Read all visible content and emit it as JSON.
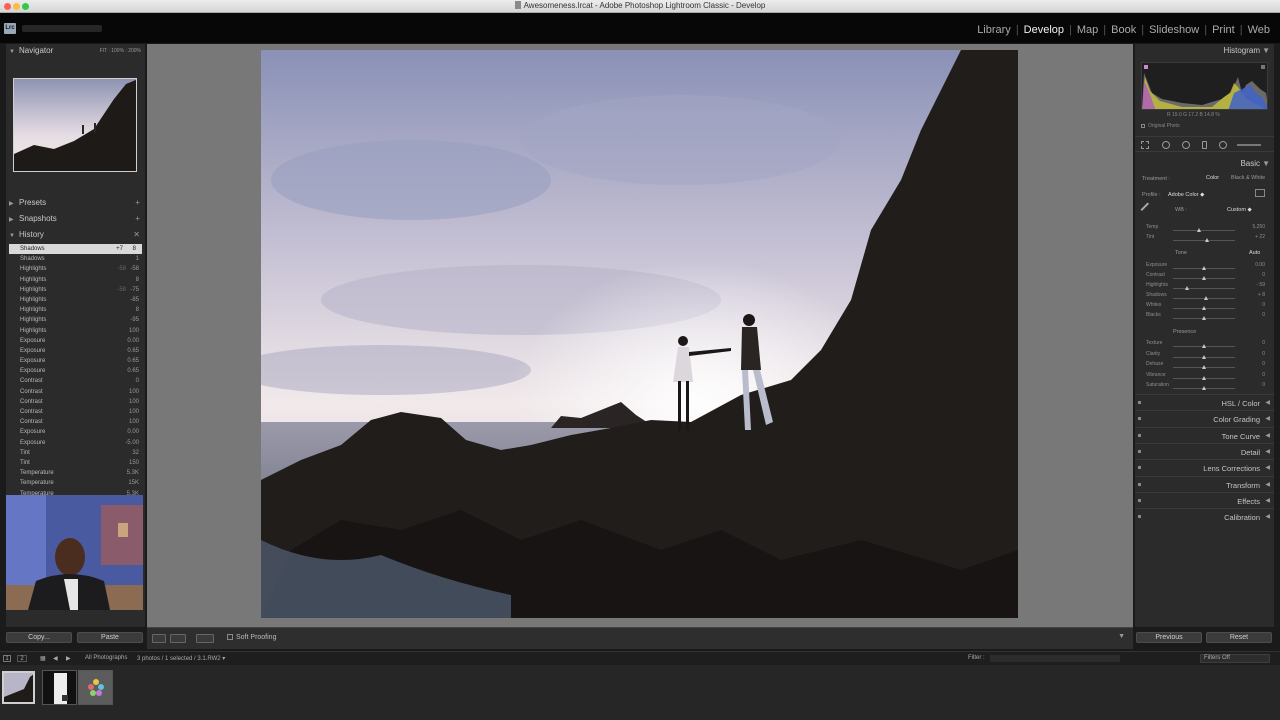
{
  "window": {
    "title": "Awesomeness.lrcat - Adobe Photoshop Lightroom Classic - Develop",
    "app_badge": "Lrc"
  },
  "modules": [
    {
      "label": "Library"
    },
    {
      "label": "Develop",
      "active": true
    },
    {
      "label": "Map"
    },
    {
      "label": "Book"
    },
    {
      "label": "Slideshow"
    },
    {
      "label": "Print"
    },
    {
      "label": "Web"
    }
  ],
  "left_panel": {
    "navigator": {
      "title": "Navigator",
      "zoom_options": [
        "FIT",
        "100%",
        "200%"
      ]
    },
    "presets": {
      "title": "Presets"
    },
    "snapshots": {
      "title": "Snapshots"
    },
    "history": {
      "title": "History",
      "items": [
        {
          "label": "Shadows",
          "v1": "+7",
          "v2": "8",
          "selected": true
        },
        {
          "label": "Shadows",
          "v1": "",
          "v2": "1"
        },
        {
          "label": "Highlights",
          "v1": "-58",
          "v2": "-58"
        },
        {
          "label": "Highlights",
          "v1": "",
          "v2": "8"
        },
        {
          "label": "Highlights",
          "v1": "-58",
          "v2": "-75"
        },
        {
          "label": "Highlights",
          "v1": "",
          "v2": "-85"
        },
        {
          "label": "Highlights",
          "v1": "",
          "v2": "8"
        },
        {
          "label": "Highlights",
          "v1": "",
          "v2": "-95"
        },
        {
          "label": "Highlights",
          "v1": "",
          "v2": "100"
        },
        {
          "label": "Exposure",
          "v1": "",
          "v2": "0.00"
        },
        {
          "label": "Exposure",
          "v1": "",
          "v2": "0.65"
        },
        {
          "label": "Exposure",
          "v1": "",
          "v2": "0.65"
        },
        {
          "label": "Exposure",
          "v1": "",
          "v2": "0.65"
        },
        {
          "label": "Contrast",
          "v1": "",
          "v2": "0"
        },
        {
          "label": "Contrast",
          "v1": "",
          "v2": "100"
        },
        {
          "label": "Contrast",
          "v1": "",
          "v2": "100"
        },
        {
          "label": "Contrast",
          "v1": "",
          "v2": "100"
        },
        {
          "label": "Contrast",
          "v1": "",
          "v2": "100"
        },
        {
          "label": "Exposure",
          "v1": "",
          "v2": "0.00"
        },
        {
          "label": "Exposure",
          "v1": "",
          "v2": "-5.00"
        },
        {
          "label": "Tint",
          "v1": "",
          "v2": "32"
        },
        {
          "label": "Tint",
          "v1": "",
          "v2": "150"
        },
        {
          "label": "Temperature",
          "v1": "",
          "v2": "5.3K"
        },
        {
          "label": "Temperature",
          "v1": "",
          "v2": "15K"
        },
        {
          "label": "Temperature",
          "v1": "",
          "v2": "5.3K"
        }
      ]
    },
    "copy_label": "Copy...",
    "paste_label": "Paste"
  },
  "right_panel": {
    "histogram": {
      "title": "Histogram",
      "readout": "R 19.0  G 17.2  B 14.8 %",
      "original_photo": "Original Photo"
    },
    "basic": {
      "title": "Basic",
      "treatment_label": "Treatment :",
      "treatment_color": "Color",
      "treatment_bw": "Black & White",
      "profile_label": "Profile :",
      "profile_value": "Adobe Color",
      "wb_label": "WB :",
      "wb_value": "Custom",
      "tone_label": "Tone",
      "auto_label": "Auto",
      "presence_label": "Presence",
      "sliders_wb": [
        {
          "label": "Temp",
          "value": "5,250",
          "pos": 0.42
        },
        {
          "label": "Tint",
          "value": "+ 22",
          "pos": 0.55
        }
      ],
      "sliders_tone": [
        {
          "label": "Exposure",
          "value": "0.00",
          "pos": 0.5
        },
        {
          "label": "Contrast",
          "value": "0",
          "pos": 0.5
        },
        {
          "label": "Highlights",
          "value": "- 59",
          "pos": 0.22
        },
        {
          "label": "Shadows",
          "value": "+ 8",
          "pos": 0.54
        },
        {
          "label": "Whites",
          "value": "0",
          "pos": 0.5
        },
        {
          "label": "Blacks",
          "value": "0",
          "pos": 0.5
        }
      ],
      "sliders_presence": [
        {
          "label": "Texture",
          "value": "0",
          "pos": 0.5
        },
        {
          "label": "Clarity",
          "value": "0",
          "pos": 0.5
        },
        {
          "label": "Dehaze",
          "value": "0",
          "pos": 0.5
        },
        {
          "label": "Vibrance",
          "value": "0",
          "pos": 0.5
        },
        {
          "label": "Saturation",
          "value": "0",
          "pos": 0.5
        }
      ]
    },
    "sections": [
      "HSL / Color",
      "Color Grading",
      "Tone Curve",
      "Detail",
      "Lens Corrections",
      "Transform",
      "Effects",
      "Calibration"
    ],
    "previous_label": "Previous",
    "reset_label": "Reset"
  },
  "toolbar": {
    "soft_proofing": "Soft Proofing"
  },
  "filmbar": {
    "source": "All Photographs",
    "info": "3 photos / 1 selected / 3.1.RW2",
    "filter_label": "Filter :",
    "filters_off": "Filters Off",
    "pages": [
      "1",
      "2"
    ]
  },
  "filmstrip": {
    "count": 3
  }
}
